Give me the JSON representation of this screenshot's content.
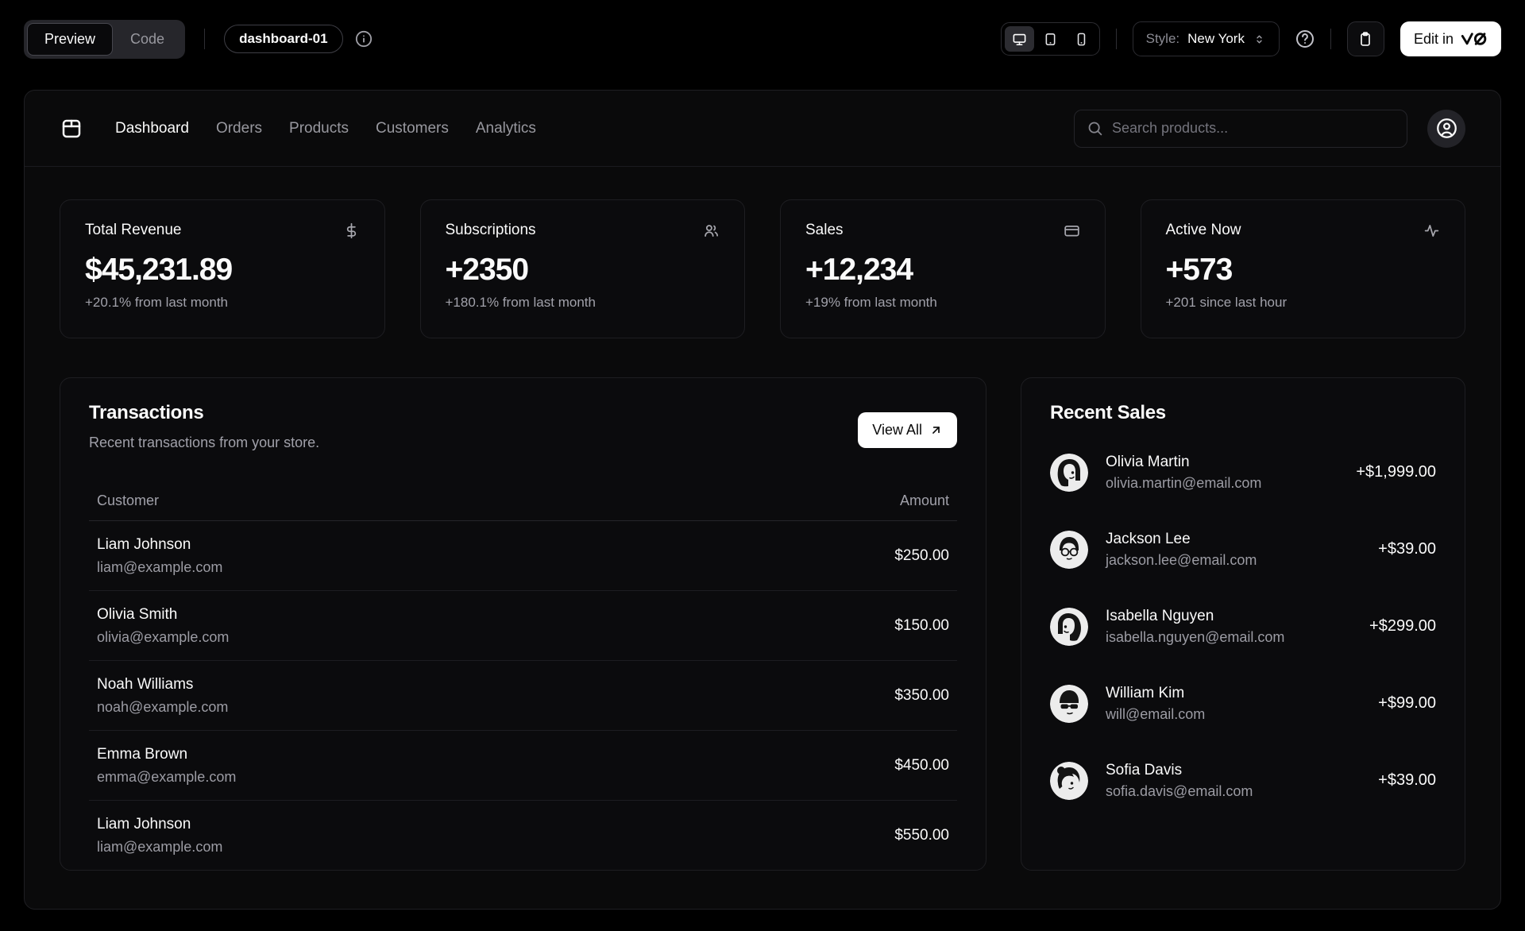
{
  "toolbar": {
    "preview_label": "Preview",
    "code_label": "Code",
    "block_name": "dashboard-01",
    "style_label": "Style:",
    "style_value": "New York",
    "edit_in_label": "Edit in",
    "edit_brand": "v0",
    "device_icons": [
      "monitor-icon",
      "tablet-icon",
      "smartphone-icon"
    ]
  },
  "nav": {
    "logo_icon": "store-icon",
    "items": [
      "Dashboard",
      "Orders",
      "Products",
      "Customers",
      "Analytics"
    ],
    "active_item": "Dashboard",
    "search_placeholder": "Search products...",
    "avatar_icon": "circle-user-icon"
  },
  "stats": [
    {
      "title": "Total Revenue",
      "icon": "dollar-sign-icon",
      "value": "$45,231.89",
      "change": "+20.1% from last month"
    },
    {
      "title": "Subscriptions",
      "icon": "users-icon",
      "value": "+2350",
      "change": "+180.1% from last month"
    },
    {
      "title": "Sales",
      "icon": "credit-card-icon",
      "value": "+12,234",
      "change": "+19% from last month"
    },
    {
      "title": "Active Now",
      "icon": "activity-icon",
      "value": "+573",
      "change": "+201 since last hour"
    }
  ],
  "transactions": {
    "title": "Transactions",
    "subtitle": "Recent transactions from your store.",
    "view_all_label": "View All",
    "view_all_icon": "arrow-up-right-icon",
    "columns": [
      "Customer",
      "Amount"
    ],
    "rows": [
      {
        "name": "Liam Johnson",
        "email": "liam@example.com",
        "amount": "$250.00"
      },
      {
        "name": "Olivia Smith",
        "email": "olivia@example.com",
        "amount": "$150.00"
      },
      {
        "name": "Noah Williams",
        "email": "noah@example.com",
        "amount": "$350.00"
      },
      {
        "name": "Emma Brown",
        "email": "emma@example.com",
        "amount": "$450.00"
      },
      {
        "name": "Liam Johnson",
        "email": "liam@example.com",
        "amount": "$550.00"
      }
    ]
  },
  "recent_sales": {
    "title": "Recent Sales",
    "rows": [
      {
        "name": "Olivia Martin",
        "email": "olivia.martin@email.com",
        "amount": "+$1,999.00"
      },
      {
        "name": "Jackson Lee",
        "email": "jackson.lee@email.com",
        "amount": "+$39.00"
      },
      {
        "name": "Isabella Nguyen",
        "email": "isabella.nguyen@email.com",
        "amount": "+$299.00"
      },
      {
        "name": "William Kim",
        "email": "will@email.com",
        "amount": "+$99.00"
      },
      {
        "name": "Sofia Davis",
        "email": "sofia.davis@email.com",
        "amount": "+$39.00"
      }
    ]
  },
  "colors": {
    "page_background": "#000000",
    "panel_background": "#0a0a0b",
    "card_background": "#0b0b0d",
    "border": "#1f1f23",
    "muted_text": "#a1a1aa",
    "primary_text": "#fafafa",
    "button_background": "#ffffff"
  }
}
